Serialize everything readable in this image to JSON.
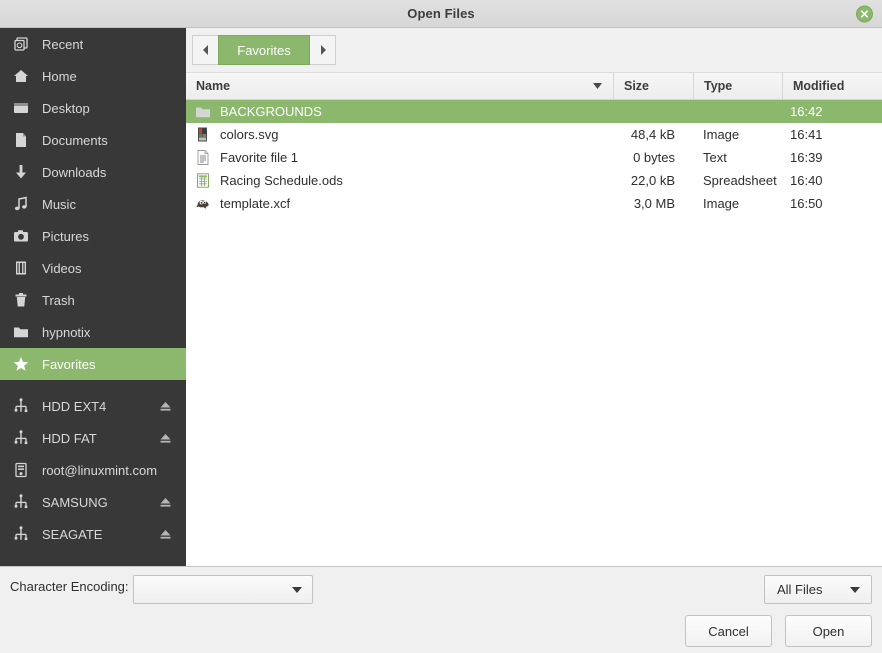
{
  "window": {
    "title": "Open Files",
    "close_icon": "close-icon"
  },
  "sidebar": {
    "places": [
      {
        "label": "Recent",
        "icon": "recent-icon",
        "selected": false,
        "eject": false
      },
      {
        "label": "Home",
        "icon": "home-icon",
        "selected": false,
        "eject": false
      },
      {
        "label": "Desktop",
        "icon": "desktop-icon",
        "selected": false,
        "eject": false
      },
      {
        "label": "Documents",
        "icon": "document-icon",
        "selected": false,
        "eject": false
      },
      {
        "label": "Downloads",
        "icon": "download-icon",
        "selected": false,
        "eject": false
      },
      {
        "label": "Music",
        "icon": "music-icon",
        "selected": false,
        "eject": false
      },
      {
        "label": "Pictures",
        "icon": "camera-icon",
        "selected": false,
        "eject": false
      },
      {
        "label": "Videos",
        "icon": "film-icon",
        "selected": false,
        "eject": false
      },
      {
        "label": "Trash",
        "icon": "trash-icon",
        "selected": false,
        "eject": false
      },
      {
        "label": "hypnotix",
        "icon": "folder-icon",
        "selected": false,
        "eject": false
      },
      {
        "label": "Favorites",
        "icon": "star-icon",
        "selected": true,
        "eject": false
      }
    ],
    "devices": [
      {
        "label": "HDD EXT4",
        "icon": "usb-drive-icon",
        "eject": true
      },
      {
        "label": "HDD FAT",
        "icon": "usb-drive-icon",
        "eject": true
      },
      {
        "label": "root@linuxmint.com",
        "icon": "server-icon",
        "eject": false
      },
      {
        "label": "SAMSUNG",
        "icon": "usb-drive-icon",
        "eject": true
      },
      {
        "label": "SEAGATE",
        "icon": "usb-drive-icon",
        "eject": true
      }
    ]
  },
  "pathbar": {
    "back_icon": "chevron-left-icon",
    "forward_icon": "chevron-right-icon",
    "crumb": "Favorites"
  },
  "filelist": {
    "columns": [
      {
        "label": "Name",
        "sorted": true
      },
      {
        "label": "Size",
        "sorted": false
      },
      {
        "label": "Type",
        "sorted": false
      },
      {
        "label": "Modified",
        "sorted": false
      }
    ],
    "sort_icon": "caret-down-icon",
    "rows": [
      {
        "name": "BACKGROUNDS",
        "size": "",
        "type": "",
        "modified": "16:42",
        "icon": "folder-icon",
        "selected": true
      },
      {
        "name": "colors.svg",
        "size": "48,4 kB",
        "type": "Image",
        "modified": "16:41",
        "icon": "svg-image-icon",
        "selected": false
      },
      {
        "name": "Favorite file 1",
        "size": "0 bytes",
        "type": "Text",
        "modified": "16:39",
        "icon": "text-file-icon",
        "selected": false
      },
      {
        "name": "Racing Schedule.ods",
        "size": "22,0 kB",
        "type": "Spreadsheet",
        "modified": "16:40",
        "icon": "spreadsheet-icon",
        "selected": false
      },
      {
        "name": "template.xcf",
        "size": "3,0 MB",
        "type": "Image",
        "modified": "16:50",
        "icon": "gimp-icon",
        "selected": false
      }
    ]
  },
  "bottom": {
    "encoding_label": "Character Encoding:",
    "encoding_value": "",
    "filter_value": "All Files",
    "dropdown_icon": "caret-down-icon",
    "cancel_label": "Cancel",
    "open_label": "Open"
  },
  "colors": {
    "accent_green": "#8cb86e",
    "sidebar_bg": "#383838",
    "titlebar_bg": "#dcdcdc",
    "list_bg": "#ffffff"
  }
}
